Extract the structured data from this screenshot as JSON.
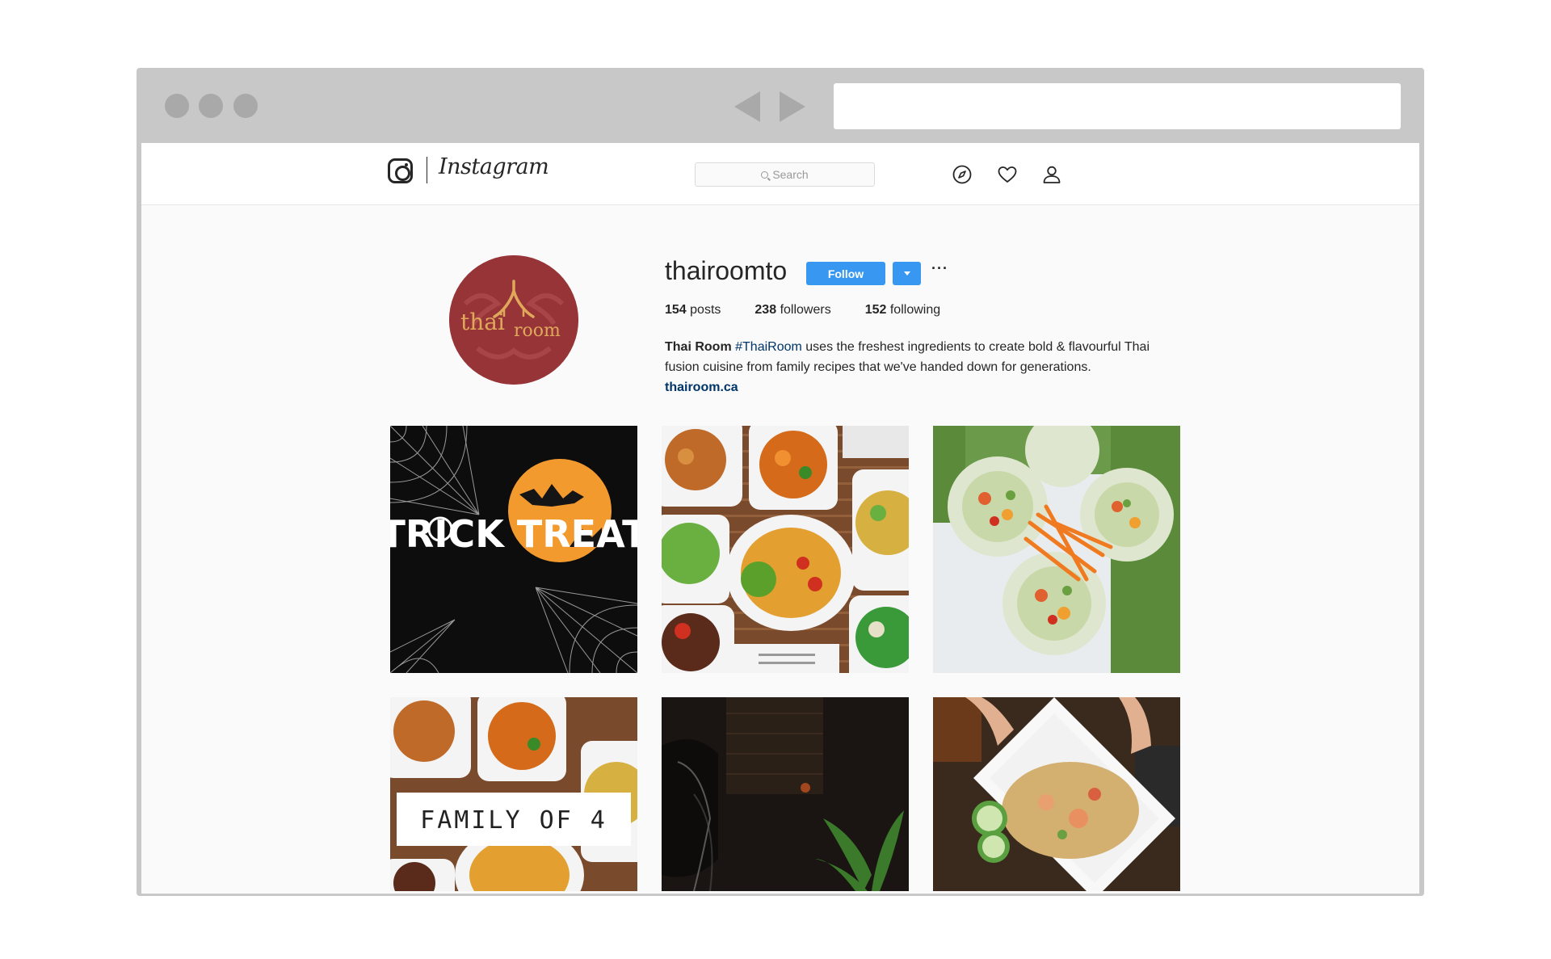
{
  "header": {
    "wordmark": "Instagram",
    "search_placeholder": "Search"
  },
  "profile": {
    "username": "thairoomto",
    "follow_label": "Follow",
    "more_label": "···",
    "avatar_text_left": "thai",
    "avatar_text_right": "room",
    "stats": {
      "posts_count": "154",
      "posts_label": "posts",
      "followers_count": "238",
      "followers_label": "followers",
      "following_count": "152",
      "following_label": "following"
    },
    "bio": {
      "name": "Thai Room",
      "hashtag": "#ThaiRoom",
      "text": "uses the freshest ingredients to create bold & flavourful Thai fusion cuisine from family recipes that we've handed down for generations.",
      "link": "thairoom.ca"
    }
  },
  "posts": [
    {
      "name": "post-trick-or-treat",
      "caption": "TRICK TREAT"
    },
    {
      "name": "post-thai-dishes-spread"
    },
    {
      "name": "post-fresh-rolls"
    },
    {
      "name": "post-family-of-4",
      "caption": "FAMILY OF 4"
    },
    {
      "name": "post-wine-glass-dark"
    },
    {
      "name": "post-fried-rice-plate"
    }
  ],
  "colors": {
    "follow_blue": "#3897f0",
    "link_blue": "#003569",
    "avatar_red": "#963438",
    "avatar_gold": "#e0a85a"
  }
}
